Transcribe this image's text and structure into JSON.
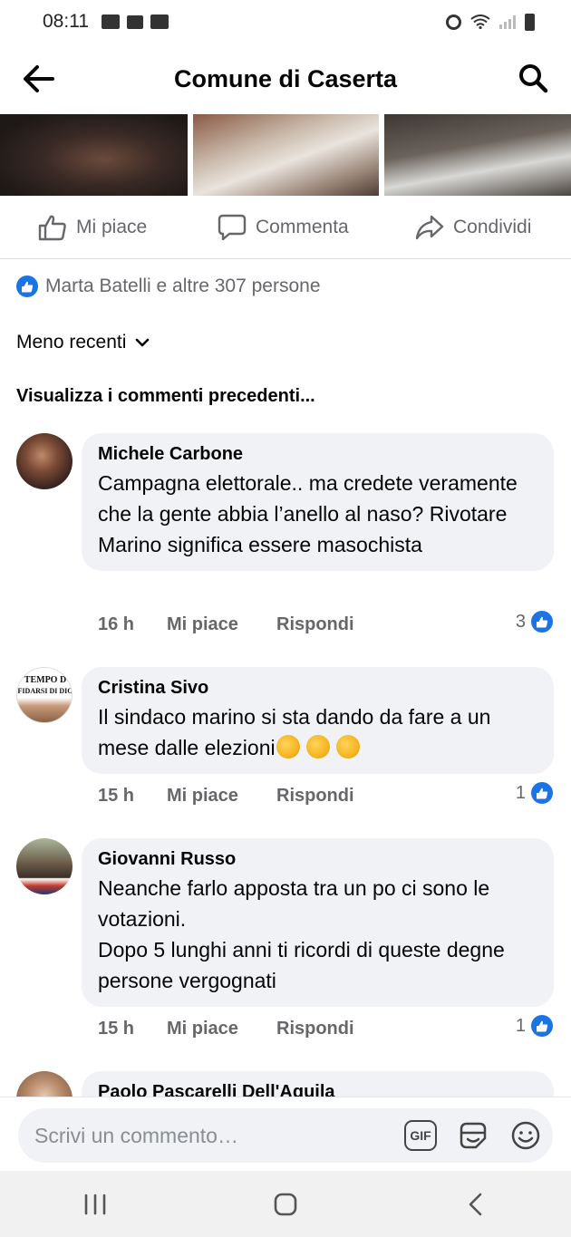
{
  "status_bar": {
    "time": "08:11"
  },
  "header": {
    "title": "Comune di Caserta"
  },
  "actions": {
    "like": "Mi piace",
    "comment": "Commenta",
    "share": "Condividi"
  },
  "reactions": {
    "summary": "Marta Batelli e altre 307 persone"
  },
  "sort": {
    "label": "Meno recenti"
  },
  "prev_comments": "Visualizza i commenti precedenti...",
  "comments": [
    {
      "author": "Michele Carbone",
      "text": "Campagna elettorale.. ma credete veramente che la gente abbia l’anello al naso? Rivotare Marino significa essere masochista",
      "time": "16 h",
      "like": "Mi piace",
      "reply": "Rispondi",
      "likes": "3"
    },
    {
      "author": "Cristina Sivo",
      "text": "Il  sindaco  marino si sta dando da fare a  un  mese dalle   elezioni",
      "time": "15 h",
      "like": "Mi piace",
      "reply": "Rispondi",
      "likes": "1"
    },
    {
      "author": "Giovanni Russo",
      "text": "Neanche farlo apposta tra un po ci sono le votazioni.\nDopo 5 lunghi anni ti ricordi di queste degne persone vergognati",
      "time": "15 h",
      "like": "Mi piace",
      "reply": "Rispondi",
      "likes": "1"
    },
    {
      "author": "Paolo Pascarelli Dell'Aquila"
    }
  ],
  "composer": {
    "placeholder": "Scrivi un commento…",
    "gif": "GIF"
  },
  "colors": {
    "facebook_blue": "#1b74e4",
    "bubble": "#f0f2f5",
    "meta_gray": "#65676b"
  }
}
